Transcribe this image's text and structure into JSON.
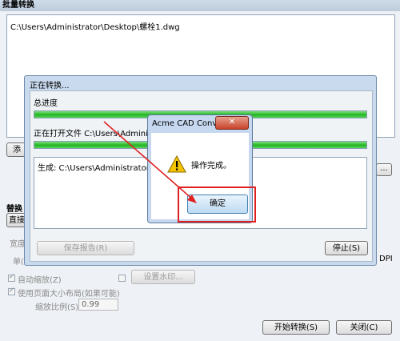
{
  "main": {
    "title": "批量转换",
    "file_list": [
      "C:\\Users\\Administrator\\Desktop\\螺栓1.dwg"
    ],
    "add_button_fragment": "添",
    "ellipsis_button": "...",
    "replace_label_fragment": "替换​",
    "direct_button_fragment": "直接",
    "width_fragment": "宽度",
    "unit_fragment": "单(",
    "dpi_fragment": "DPI",
    "auto_zoom": "自动缩放(Z)",
    "watermark_button": "设置水印...",
    "use_page_size": "使用页面大小布局(如果可能)",
    "scale_label": "缩放比例(S)",
    "scale_value": "0.99",
    "start_button": "开始转换(S)",
    "close_button": "关闭(C)"
  },
  "progress_dialog": {
    "title": "正在转换...",
    "overall_label": "总进度",
    "overall_progress": 1.0,
    "opening_label": "正在打开文件 C:\\Users\\Administrator",
    "file_progress": 1.0,
    "log_text": "生成: C:\\Users\\Administrator\\Desktop",
    "save_report_button": "保存报告(R)",
    "stop_button": "停止(S)"
  },
  "message_box": {
    "title": "Acme CAD Conver...",
    "close_icon": "✕",
    "message": "操作完成。",
    "icon": "warning-icon",
    "ok_button": "确定"
  },
  "colors": {
    "highlight": "#e02020",
    "progress": "#22b522"
  }
}
